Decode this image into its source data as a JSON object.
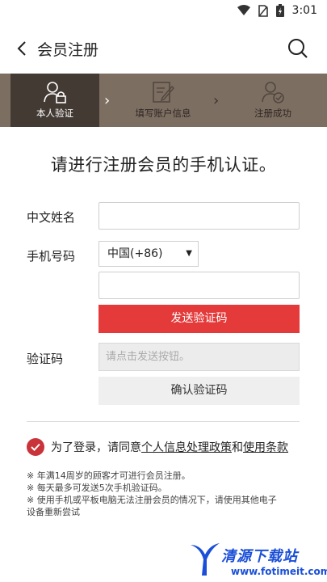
{
  "status_bar": {
    "time": "3:01"
  },
  "header": {
    "title": "会员注册"
  },
  "steps": [
    {
      "label": "本人验证"
    },
    {
      "label": "填写账户信息"
    },
    {
      "label": "注册成功"
    }
  ],
  "headline": "请进行注册会员的手机认证。",
  "form": {
    "name_label": "中文姓名",
    "name_value": "",
    "phone_label": "手机号码",
    "country_code": "中国(+86)",
    "phone_value": "",
    "send_code_button": "发送验证码",
    "code_label": "验证码",
    "code_placeholder": "请点击发送按钮。",
    "confirm_code_button": "确认验证码"
  },
  "agreement": {
    "prefix": "为了登录，请同意",
    "privacy_link": "个人信息处理政策",
    "and": "和",
    "terms_link": "使用条款"
  },
  "notes": [
    "※ 年满14周岁的顾客才可进行会员注册。",
    "※ 每天最多可发送5次手机验证码。",
    "※ 使用手机或平板电脑无法注册会员的情况下，请使用其他电子",
    "设备重新尝试"
  ],
  "watermark": {
    "title": "清源下载站",
    "url": "www.fotimeit.com"
  },
  "colors": {
    "step_bar": "#7d6e62",
    "step_active": "#433a34",
    "primary_red": "#e43a3a",
    "check_red": "#c9333a"
  }
}
